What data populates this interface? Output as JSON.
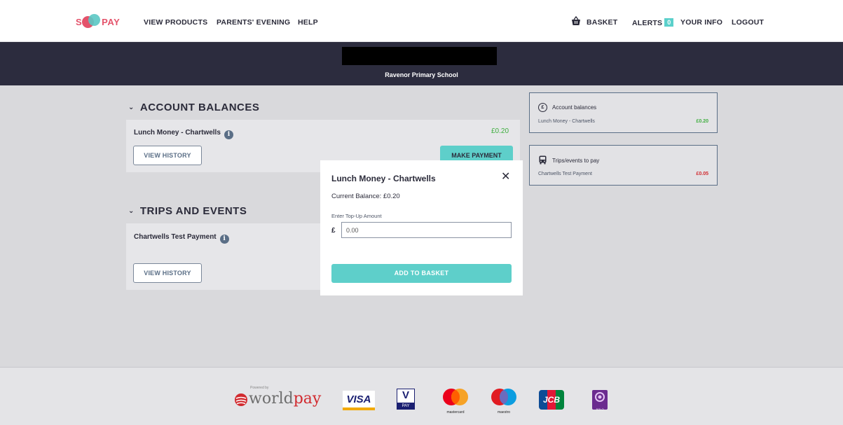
{
  "brand": {
    "logo_left": "S",
    "logo_right": "PAY",
    "color_accent": "#5ecfca",
    "color_brand": "#e4536b"
  },
  "nav": {
    "left_links": [
      "VIEW PRODUCTS",
      "PARENTS' EVENING",
      "HELP"
    ],
    "basket": "BASKET",
    "basket_icon": "basket-icon",
    "alerts": "ALERTS",
    "alerts_count": "0",
    "your_info": "YOUR INFO",
    "logout": "LOGOUT"
  },
  "banner": {
    "school_name": "Ravenor Primary School"
  },
  "account_balances": {
    "title": "ACCOUNT BALANCES",
    "item_name": "Lunch Money - Chartwells",
    "item_amount": "£0.20",
    "view_history": "VIEW HISTORY",
    "make_payment": "MAKE PAYMENT"
  },
  "trips_events": {
    "title": "TRIPS AND EVENTS",
    "item_name": "Chartwells Test Payment",
    "view_history": "VIEW HISTORY"
  },
  "summary": {
    "balances_title": "Account balances",
    "balances_row": "Lunch Money - Chartwells",
    "balances_amount": "£0.20",
    "trips_title": "Trips/events to pay",
    "trips_row": "Chartwells Test Payment",
    "trips_amount": "£0.05",
    "color_positive": "#3eae3e",
    "color_due": "#d12a2f"
  },
  "modal": {
    "title": "Lunch Money - Chartwells",
    "close_icon": "close-icon",
    "balance": "Current Balance: £0.20",
    "input_label": "Enter Top-Up Amount",
    "currency": "£",
    "input_value": "0.00",
    "add_button": "ADD TO BASKET"
  },
  "footer": {
    "worldpay_powered": "Powered by",
    "worldpay_world": "world",
    "worldpay_pay": "pay",
    "visa": "VISA",
    "vpay_v": "V",
    "vpay_pay": "PAY",
    "mastercard": "mastercard",
    "maestro": "maestro",
    "jcb": "JCB",
    "solo": "SOLO"
  }
}
